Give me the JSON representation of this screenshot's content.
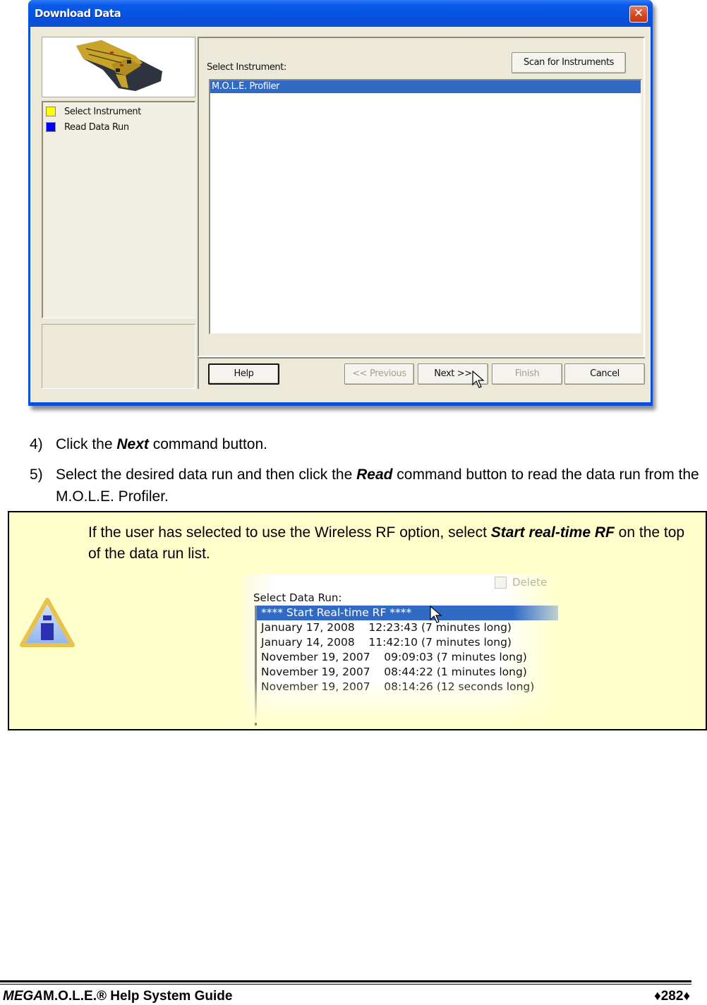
{
  "dialog": {
    "title": "Download Data",
    "close_icon": "close-icon",
    "steps": [
      {
        "label": "Select Instrument",
        "color": "#ffff00"
      },
      {
        "label": "Read Data Run",
        "color": "#0000ff"
      }
    ],
    "select_label": "Select Instrument:",
    "scan_button": "Scan for Instruments",
    "instruments": [
      {
        "label": "M.O.L.E. Profiler",
        "selected": true
      }
    ],
    "buttons": {
      "help": "Help",
      "previous": "<< Previous",
      "next": "Next >>",
      "finish": "Finish",
      "cancel": "Cancel"
    }
  },
  "steps": [
    {
      "number": "4)",
      "pre": "Click the ",
      "emph": "Next",
      "post": " command button."
    },
    {
      "number": "5)",
      "pre": "Select the desired data run and then click the ",
      "emph": "Read",
      "post": " command button to read the data run from the M.O.L.E. Profiler."
    }
  ],
  "note": {
    "icon": "info-warning-icon",
    "pre": "If the user has selected to use the Wireless RF option, select ",
    "emph1": "Start real-time RF",
    "post": " on the top of the data run list.",
    "screenshot": {
      "label": "Select Data Run:",
      "delete_label": "Delete",
      "items": [
        "**** Start Real-time RF ****",
        "January 17, 2008    12:23:43 (7 minutes long)",
        "January 14, 2008    11:42:10 (7 minutes long)",
        "November 19, 2007    09:09:03 (7 minutes long)",
        "November 19, 2007    08:44:22 (1 minutes long)",
        "November 19, 2007    08:14:26 (12 seconds long)"
      ]
    }
  },
  "footer": {
    "brand_italic": "MEGA",
    "brand_rest": "M.O.L.E.® Help System Guide",
    "page": "♦282♦"
  }
}
